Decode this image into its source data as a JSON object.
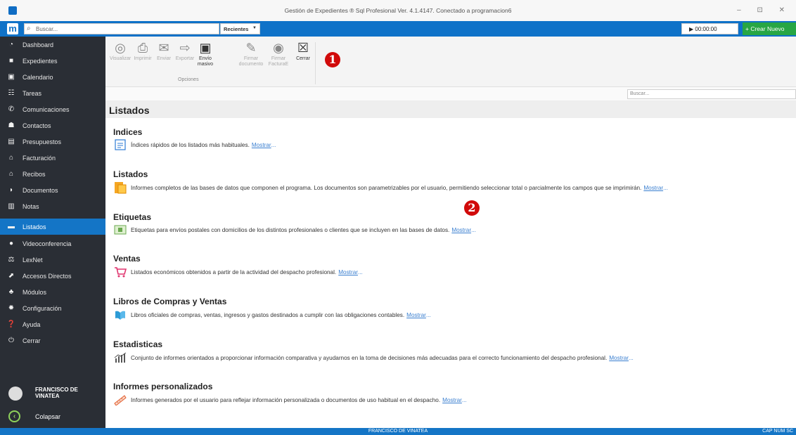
{
  "window": {
    "title": "Gestión de Expedientes ® Sql Profesional Ver. 4.1.4147. Conectado a programacion6",
    "controls": "–  ⊡  ✕"
  },
  "topbar": {
    "logo": "m",
    "search_placeholder": "Buscar...",
    "recent_label": "Recientes",
    "timer": "▶ 00:00:00",
    "create_label": "+ Crear Nuevo",
    "colors": {
      "bar": "#0f72c8",
      "create": "#27a644"
    }
  },
  "sidebar": {
    "items": [
      {
        "label": "Dashboard",
        "icon": "dashboard-icon"
      },
      {
        "label": "Expedientes",
        "icon": "briefcase-icon"
      },
      {
        "label": "Calendario",
        "icon": "calendar-icon"
      },
      {
        "label": "Tareas",
        "icon": "tasks-icon"
      },
      {
        "label": "Comunicaciones",
        "icon": "communications-icon"
      },
      {
        "label": "Contactos",
        "icon": "contacts-icon"
      },
      {
        "label": "Presupuestos",
        "icon": "budget-icon"
      },
      {
        "label": "Facturación",
        "icon": "billing-icon"
      },
      {
        "label": "Recibos",
        "icon": "receipts-icon"
      },
      {
        "label": "Documentos",
        "icon": "documents-icon"
      },
      {
        "label": "Notas",
        "icon": "notes-icon"
      },
      {
        "label": "Listados",
        "icon": "listados-icon",
        "active": true
      },
      {
        "label": "Videoconferencia",
        "icon": "video-icon"
      },
      {
        "label": "LexNet",
        "icon": "scales-icon"
      },
      {
        "label": "Accesos Directos",
        "icon": "shortcut-icon"
      },
      {
        "label": "Módulos",
        "icon": "modules-icon"
      },
      {
        "label": "Configuración",
        "icon": "gear-icon"
      },
      {
        "label": "Ayuda",
        "icon": "help-icon"
      },
      {
        "label": "Cerrar",
        "icon": "power-icon"
      }
    ],
    "user_name": "FRANCISCO DE\nVINATEA",
    "collapse_label": "Colapsar"
  },
  "toolbar": {
    "buttons": [
      {
        "label": "Visualizar",
        "glyph": "◎",
        "enabled": false
      },
      {
        "label": "Imprimir",
        "glyph": "⎙",
        "enabled": false
      },
      {
        "label": "Enviar",
        "glyph": "✉",
        "enabled": false
      },
      {
        "label": "Exportar",
        "glyph": "⇨",
        "enabled": false
      },
      {
        "label": "Envío masivo",
        "glyph": "▣",
        "enabled": true
      },
      {
        "label": "Firmar documento",
        "glyph": "✎",
        "enabled": false
      },
      {
        "label": "Firmar FacturaE",
        "glyph": "◉",
        "enabled": false
      },
      {
        "label": "Cerrar",
        "glyph": "☒",
        "enabled": true
      }
    ],
    "group_label": "Opciones",
    "marker_1": "1"
  },
  "filter": {
    "placeholder": "Buscar..."
  },
  "main": {
    "title": "Listados",
    "marker_2": "2",
    "link_label": "Mostrar",
    "categories": [
      {
        "title": "Indices",
        "icon": "index-icon",
        "description": "Índices rápidos de los listados más habituales."
      },
      {
        "title": "Listados",
        "icon": "listados-doc-icon",
        "description": "Informes completos de las bases de datos que componen el programa. Los documentos son parametrizables por el usuario, permitiendo seleccionar total o parcialmente los campos que se imprimirán."
      },
      {
        "title": "Etiquetas",
        "icon": "label-icon",
        "description": "Etiquetas para envíos postales con domicilios de los distintos profesionales o clientes que se incluyen en las bases de datos."
      },
      {
        "title": "Ventas",
        "icon": "cart-icon",
        "description": "Listados económicos obtenidos a partir de la actividad del despacho profesional."
      },
      {
        "title": "Libros de Compras y Ventas",
        "icon": "books-icon",
        "description": "Libros oficiales de compras, ventas, ingresos y gastos destinados a cumplir con las obligaciones contables."
      },
      {
        "title": "Estadisticas",
        "icon": "stats-icon",
        "description": "Conjunto de informes orientados a proporcionar información comparativa y ayudarnos en la toma de decisiones más adecuadas para el correcto funcionamiento del despacho profesional."
      },
      {
        "title": "Informes personalizados",
        "icon": "ruler-icon",
        "description": "Informes generados por el usuario para reflejar información personalizada o documentos de uso habitual en el despacho."
      }
    ]
  },
  "status": {
    "user": "FRANCISCO DE VINATEA",
    "indicators": "CAP NUM SC"
  }
}
